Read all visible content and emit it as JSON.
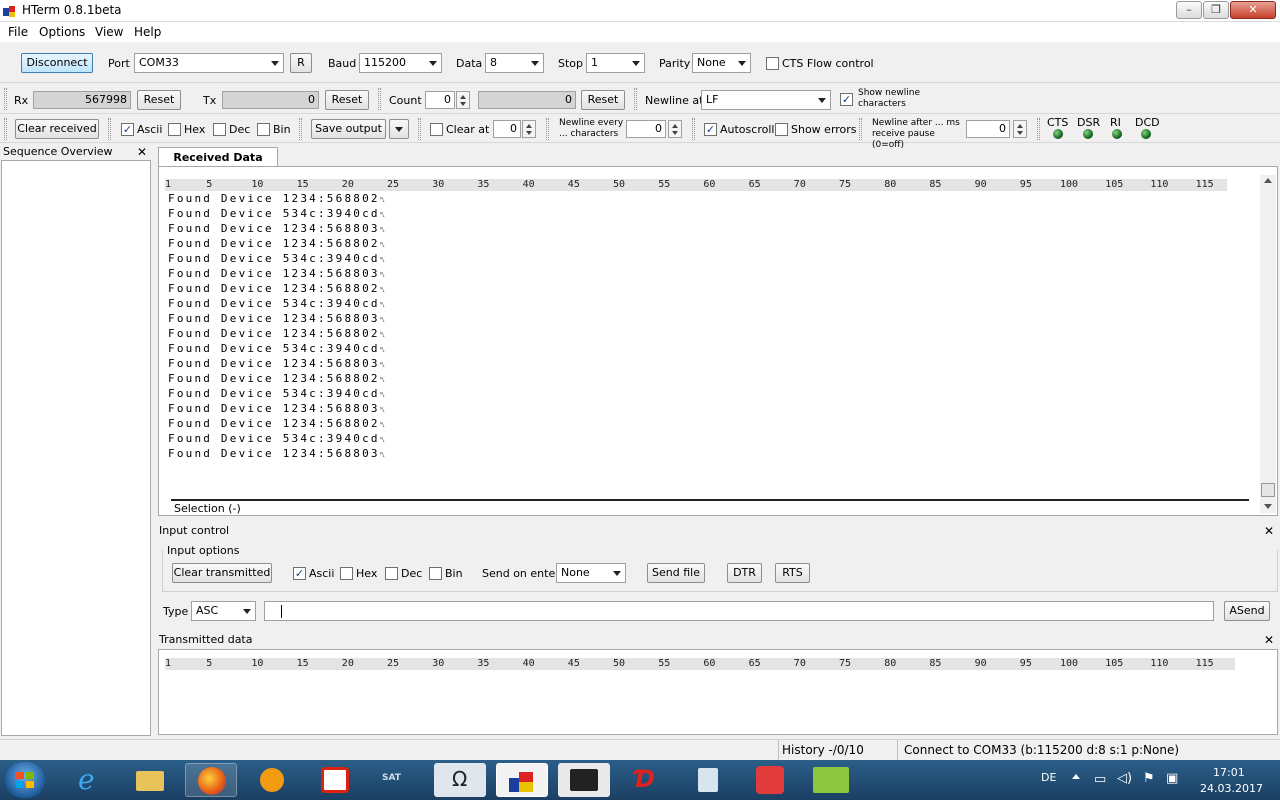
{
  "window": {
    "title": "HTerm 0.8.1beta",
    "min": "–",
    "max": "❐",
    "close": "✕"
  },
  "menu": [
    "File",
    "Options",
    "View",
    "Help"
  ],
  "conn": {
    "disconnect": "Disconnect",
    "port_label": "Port",
    "port": "COM33",
    "r": "R",
    "baud_label": "Baud",
    "baud": "115200",
    "data_label": "Data",
    "data": "8",
    "stop_label": "Stop",
    "stop": "1",
    "parity_label": "Parity",
    "parity": "None",
    "cts": "CTS Flow control"
  },
  "counters": {
    "rx_label": "Rx",
    "rx": "567998",
    "reset": "Reset",
    "tx_label": "Tx",
    "tx": "0",
    "count_label": "Count",
    "count": "0",
    "count2": "0",
    "newline_label": "Newline at",
    "newline": "LF",
    "show_newline": "Show newline characters"
  },
  "toolbar": {
    "clear_received": "Clear received",
    "ascii": "Ascii",
    "hex": "Hex",
    "dec": "Dec",
    "bin": "Bin",
    "save_output": "Save output",
    "clear_at": "Clear at",
    "clear_at_val": "0",
    "newline_every": "Newline every ... characters",
    "newline_every_val": "0",
    "autoscroll": "Autoscroll",
    "show_errors": "Show errors",
    "newline_after": "Newline after ... ms receive pause (0=off)",
    "newline_after_val": "0",
    "signals": [
      "CTS",
      "DSR",
      "RI",
      "DCD"
    ]
  },
  "sequence": {
    "title": "Sequence Overview",
    "close": "✕"
  },
  "received": {
    "tab": "Received Data",
    "ruler": [
      "1",
      "5",
      "10",
      "15",
      "20",
      "25",
      "30",
      "35",
      "40",
      "45",
      "50",
      "55",
      "60",
      "65",
      "70",
      "75",
      "80",
      "85",
      "90",
      "95",
      "100",
      "105",
      "110",
      "115"
    ],
    "lines": [
      "Found Device 1234:568802",
      "Found Device 534c:3940cd",
      "Found Device 1234:568803",
      "Found Device 1234:568802",
      "Found Device 534c:3940cd",
      "Found Device 1234:568803",
      "Found Device 1234:568802",
      "Found Device 534c:3940cd",
      "Found Device 1234:568803",
      "Found Device 1234:568802",
      "Found Device 534c:3940cd",
      "Found Device 1234:568803",
      "Found Device 1234:568802",
      "Found Device 534c:3940cd",
      "Found Device 1234:568803",
      "Found Device 1234:568802",
      "Found Device 534c:3940cd",
      "Found Device 1234:568803"
    ],
    "newline_mark": "␤",
    "selection": "Selection (-)"
  },
  "input": {
    "title": "Input control",
    "close": "✕",
    "options_label": "Input options",
    "clear_transmitted": "Clear transmitted",
    "ascii": "Ascii",
    "hex": "Hex",
    "dec": "Dec",
    "bin": "Bin",
    "send_on_enter_label": "Send on enter",
    "send_on_enter": "None",
    "send_file": "Send file",
    "dtr": "DTR",
    "rts": "RTS",
    "type_label": "Type",
    "type": "ASC",
    "asend": "ASend"
  },
  "transmitted": {
    "title": "Transmitted data",
    "close": "✕"
  },
  "status": {
    "history": "History -/0/10",
    "connection": "Connect to COM33 (b:115200 d:8 s:1 p:None)"
  },
  "taskbar": {
    "lang": "DE",
    "time": "17:01",
    "date": "24.03.2017"
  }
}
